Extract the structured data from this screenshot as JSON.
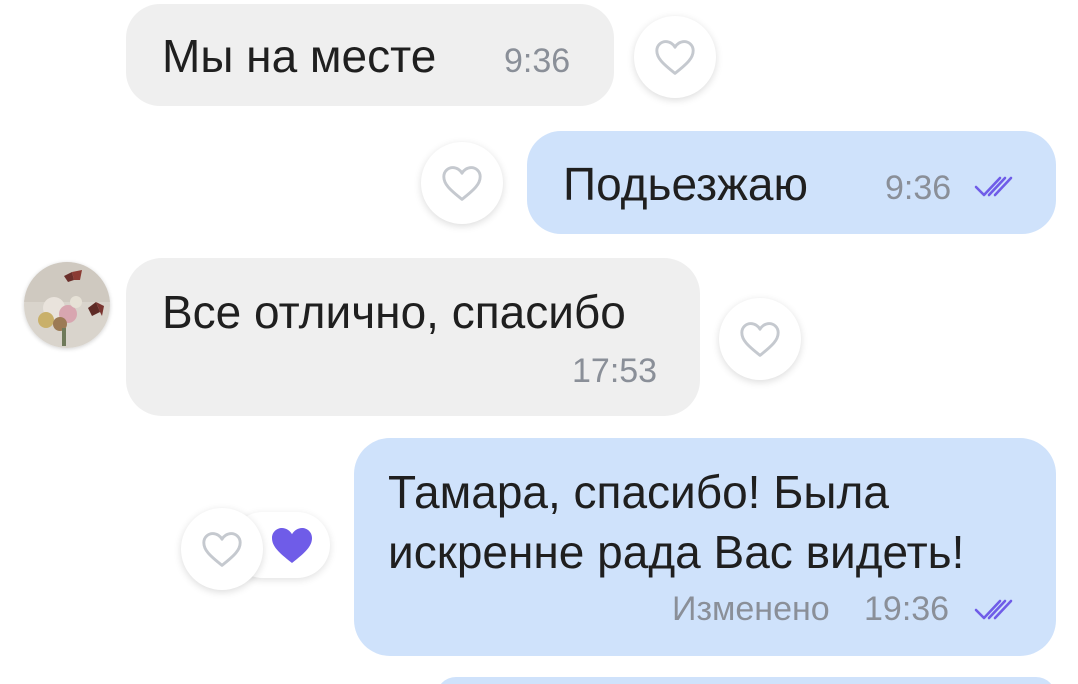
{
  "messages": [
    {
      "id": "m1",
      "direction": "incoming",
      "text": "Мы на месте",
      "time": "9:36",
      "liked": false
    },
    {
      "id": "m2",
      "direction": "outgoing",
      "text": "Подьезжаю",
      "time": "9:36",
      "status_icon": "double-check-icon",
      "liked": false
    },
    {
      "id": "m3",
      "direction": "incoming",
      "text": "Все отлично, спасибо",
      "time": "17:53",
      "has_avatar": true,
      "liked": false
    },
    {
      "id": "m4",
      "direction": "outgoing",
      "text_lines": [
        "Тамара,  спасибо! Была",
        "искренне рада Вас видеть!"
      ],
      "edited_label": "Изменено",
      "time": "19:36",
      "status_icon": "double-check-icon",
      "liked": false,
      "reaction": "purple-heart-icon"
    }
  ],
  "colors": {
    "incoming_bubble": "#efefef",
    "outgoing_bubble": "#cfe2fb",
    "accent": "#6f5ce8",
    "time_text": "#8a8f98"
  }
}
